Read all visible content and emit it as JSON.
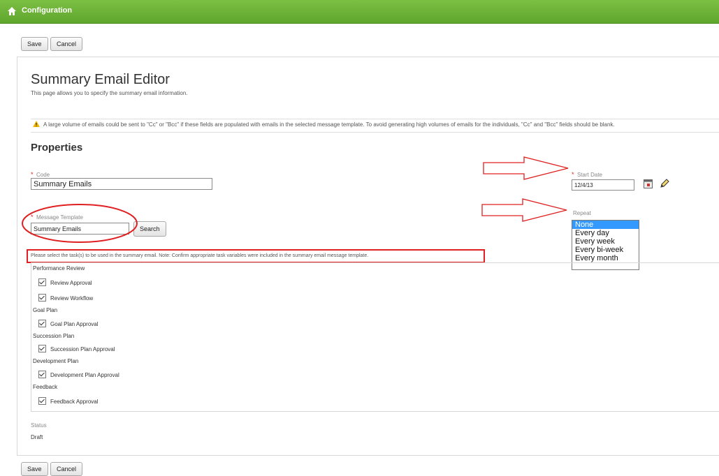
{
  "header": {
    "title": "Configuration",
    "home_icon": "home-icon"
  },
  "toolbar_top": {
    "save": "Save",
    "cancel": "Cancel"
  },
  "toolbar_bottom": {
    "save": "Save",
    "cancel": "Cancel"
  },
  "page": {
    "title": "Summary Email Editor",
    "description": "This page allows you to specify the summary email information.",
    "warning": "A large volume of emails could be sent to \"Cc\" or \"Bcc\" if these fields are populated with emails in the selected message template. To avoid generating high volumes of emails for the individuals, \"Cc\" and \"Bcc\" fields should be blank."
  },
  "properties": {
    "heading": "Properties",
    "code_label": "Code",
    "code_value": "Summary Emails",
    "template_label": "Message Template",
    "template_value": "Summary Emails",
    "search_label": "Search",
    "start_date_label": "Start Date",
    "start_date_value": "12/4/13",
    "repeat_label": "Repeat",
    "repeat_options": [
      "None",
      "Every day",
      "Every week",
      "Every bi-week",
      "Every month"
    ],
    "repeat_selected": "None"
  },
  "tasks": {
    "instructions": "Please select the task(s) to be used in the summary email. Note: Confirm appropriate task variables were included in the summary email message template.",
    "groups": [
      {
        "name": "Performance Review",
        "items": [
          "Review Approval",
          "Review Workflow"
        ]
      },
      {
        "name": "Goal Plan",
        "items": [
          "Goal Plan Approval"
        ]
      },
      {
        "name": "Succession Plan",
        "items": [
          "Succession Plan Approval"
        ]
      },
      {
        "name": "Development Plan",
        "items": [
          "Development Plan Approval"
        ]
      },
      {
        "name": "Feedback",
        "items": [
          "Feedback Approval"
        ]
      }
    ]
  },
  "status": {
    "label": "Status",
    "value": "Draft"
  },
  "colors": {
    "header_green": "#6cb33f",
    "annotation_red": "#e02020",
    "selection_blue": "#3399ff"
  }
}
